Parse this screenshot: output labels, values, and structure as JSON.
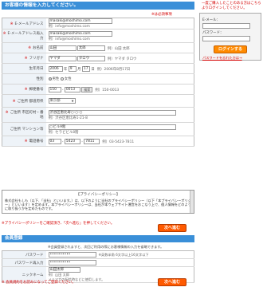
{
  "header": {
    "title": "お客様の情報を入力してください。",
    "required_note": "※は必須事項"
  },
  "form": {
    "email": {
      "label": "E-メールアドレス",
      "value": "masaki@moshimo.com",
      "example": "例）info@moshimo.com"
    },
    "email_confirm": {
      "label": "E-メールアドレス再入力",
      "value": "masaki@moshimo.com",
      "example": "例）info@moshimo.com"
    },
    "name": {
      "label": "お名前",
      "last": "山田",
      "first": "太郎",
      "example": "例）山田 太郎"
    },
    "furigana": {
      "label": "フリガナ",
      "last": "ヤマダ",
      "first": "タロウ",
      "example": "例）ヤマダ タロウ"
    },
    "birth": {
      "label": "生年月日",
      "year": "2006",
      "year_unit": "年",
      "month": "9",
      "month_unit": "月",
      "day": "17",
      "day_unit": "日",
      "example": "例）2006年8月17日"
    },
    "gender": {
      "label": "性別",
      "male": "男性",
      "female": "女性"
    },
    "zip": {
      "label": "郵便番号",
      "part1": "150",
      "part2": "0013",
      "button": "検索",
      "example": "例）150-0013"
    },
    "pref": {
      "label": "ご住所 都道府県",
      "value": "東京都"
    },
    "city": {
      "label": "ご住所 市区町村・番地",
      "value": "渋谷区恵比寿○-○-○",
      "example": "例）渋谷区恵比寿1-21-8"
    },
    "building": {
      "label": "ご住所 マンション等",
      "value": "○ビル9階",
      "example": "例）セラビビル8階"
    },
    "phone": {
      "label": "電話番号",
      "p1": "03",
      "p2": "5423",
      "p3": "7811",
      "example": "例）03-5423-7811"
    }
  },
  "login": {
    "note": "一度ご購入したことのある方はこちらよりログインしてください。",
    "email_label": "E-メール：",
    "password_label": "パスワード：",
    "button": "ログインする",
    "forgot": "パスワードを忘れた方は→"
  },
  "policy": {
    "title": "【プライバシーポリシー】",
    "body": "株式会社もしも（以下、「当社」といいます。）は、以下のように当社のプライバシーポリシー（以下「本プライバシーポリシー」といいます）を定めます。本プライバシーポリシーは、当社が本ウェブサイト運営をおこなう上で、個人情報をどのように取り扱うかを定めたものです。"
  },
  "privacy_note": "※プライバシーポリシーをご確認頂き、「次へ進む」を押してください。",
  "next_label": "次へ進む",
  "member": {
    "title": "会員登録",
    "note": "※会員登録されますと、次回ご利用の際にお客様情報の入力を省略できます。",
    "password": {
      "label": "パスワード",
      "value": "••••••••••",
      "hint": "※英数半角 6文字以上16文字以下"
    },
    "password_confirm": {
      "label": "パスワード再入力",
      "value": "••••••••••"
    },
    "nickname": {
      "label": "ニックネーム",
      "value": "山田太郎",
      "example": "例）山田 太郎",
      "hint": "メルマガの配信時などに使用します。"
    }
  },
  "bottom_note": "※ 会員規約をお読みになってご登録ください。"
}
